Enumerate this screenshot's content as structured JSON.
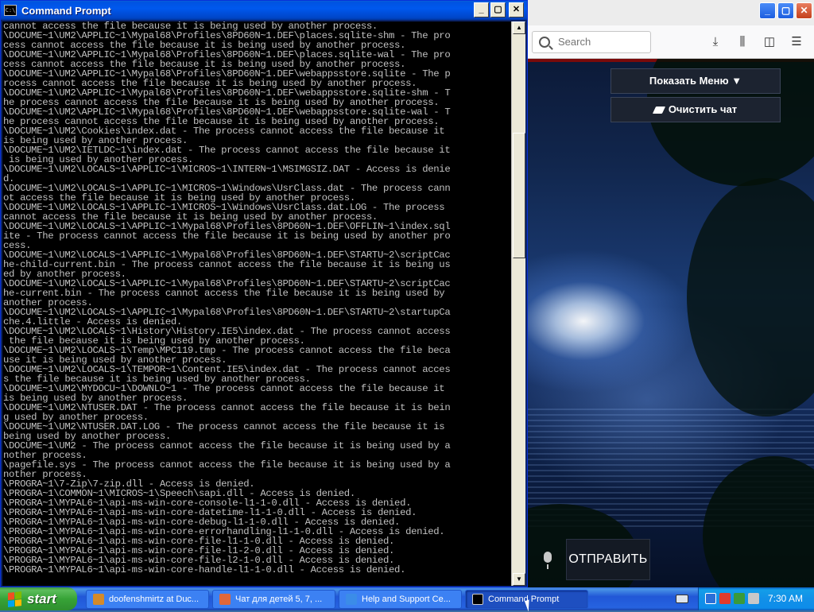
{
  "cmd": {
    "title": "Command Prompt",
    "icon": "C:\\",
    "buttons": {
      "minimize": "_",
      "maximize": "▢",
      "close": "✕"
    },
    "lines": [
      "cannot access the file because it is being used by another process.",
      "\\DOCUME~1\\UM2\\APPLIC~1\\Mypal68\\Profiles\\8PD60N~1.DEF\\places.sqlite-shm - The pro",
      "cess cannot access the file because it is being used by another process.",
      "\\DOCUME~1\\UM2\\APPLIC~1\\Mypal68\\Profiles\\8PD60N~1.DEF\\places.sqlite-wal - The pro",
      "cess cannot access the file because it is being used by another process.",
      "\\DOCUME~1\\UM2\\APPLIC~1\\Mypal68\\Profiles\\8PD60N~1.DEF\\webappsstore.sqlite - The p",
      "rocess cannot access the file because it is being used by another process.",
      "\\DOCUME~1\\UM2\\APPLIC~1\\Mypal68\\Profiles\\8PD60N~1.DEF\\webappsstore.sqlite-shm - T",
      "he process cannot access the file because it is being used by another process.",
      "\\DOCUME~1\\UM2\\APPLIC~1\\Mypal68\\Profiles\\8PD60N~1.DEF\\webappsstore.sqlite-wal - T",
      "he process cannot access the file because it is being used by another process.",
      "\\DOCUME~1\\UM2\\Cookies\\index.dat - The process cannot access the file because it",
      "is being used by another process.",
      "\\DOCUME~1\\UM2\\IETLDC~1\\index.dat - The process cannot access the file because it",
      " is being used by another process.",
      "\\DOCUME~1\\UM2\\LOCALS~1\\APPLIC~1\\MICROS~1\\INTERN~1\\MSIMGSIZ.DAT - Access is denie",
      "d.",
      "\\DOCUME~1\\UM2\\LOCALS~1\\APPLIC~1\\MICROS~1\\Windows\\UsrClass.dat - The process cann",
      "ot access the file because it is being used by another process.",
      "\\DOCUME~1\\UM2\\LOCALS~1\\APPLIC~1\\MICROS~1\\Windows\\UsrClass.dat.LOG - The process",
      "cannot access the file because it is being used by another process.",
      "\\DOCUME~1\\UM2\\LOCALS~1\\APPLIC~1\\Mypal68\\Profiles\\8PD60N~1.DEF\\OFFLIN~1\\index.sql",
      "ite - The process cannot access the file because it is being used by another pro",
      "cess.",
      "\\DOCUME~1\\UM2\\LOCALS~1\\APPLIC~1\\Mypal68\\Profiles\\8PD60N~1.DEF\\STARTU~2\\scriptCac",
      "he-child-current.bin - The process cannot access the file because it is being us",
      "ed by another process.",
      "\\DOCUME~1\\UM2\\LOCALS~1\\APPLIC~1\\Mypal68\\Profiles\\8PD60N~1.DEF\\STARTU~2\\scriptCac",
      "he-current.bin - The process cannot access the file because it is being used by",
      "another process.",
      "\\DOCUME~1\\UM2\\LOCALS~1\\APPLIC~1\\Mypal68\\Profiles\\8PD60N~1.DEF\\STARTU~2\\startupCa",
      "che.4.little - Access is denied.",
      "\\DOCUME~1\\UM2\\LOCALS~1\\History\\History.IE5\\index.dat - The process cannot access",
      " the file because it is being used by another process.",
      "\\DOCUME~1\\UM2\\LOCALS~1\\Temp\\MPC119.tmp - The process cannot access the file beca",
      "use it is being used by another process.",
      "\\DOCUME~1\\UM2\\LOCALS~1\\TEMPOR~1\\Content.IE5\\index.dat - The process cannot acces",
      "s the file because it is being used by another process.",
      "\\DOCUME~1\\UM2\\MYDOCU~1\\DOWNLO~1 - The process cannot access the file because it",
      "is being used by another process.",
      "\\DOCUME~1\\UM2\\NTUSER.DAT - The process cannot access the file because it is bein",
      "g used by another process.",
      "\\DOCUME~1\\UM2\\NTUSER.DAT.LOG - The process cannot access the file because it is",
      "being used by another process.",
      "\\DOCUME~1\\UM2 - The process cannot access the file because it is being used by a",
      "nother process.",
      "\\pagefile.sys - The process cannot access the file because it is being used by a",
      "nother process.",
      "\\PROGRA~1\\7-Zip\\7-zip.dll - Access is denied.",
      "\\PROGRA~1\\COMMON~1\\MICROS~1\\Speech\\sapi.dll - Access is denied.",
      "\\PROGRA~1\\MYPAL6~1\\api-ms-win-core-console-l1-1-0.dll - Access is denied.",
      "\\PROGRA~1\\MYPAL6~1\\api-ms-win-core-datetime-l1-1-0.dll - Access is denied.",
      "\\PROGRA~1\\MYPAL6~1\\api-ms-win-core-debug-l1-1-0.dll - Access is denied.",
      "\\PROGRA~1\\MYPAL6~1\\api-ms-win-core-errorhandling-l1-1-0.dll - Access is denied.",
      "\\PROGRA~1\\MYPAL6~1\\api-ms-win-core-file-l1-1-0.dll - Access is denied.",
      "\\PROGRA~1\\MYPAL6~1\\api-ms-win-core-file-l1-2-0.dll - Access is denied.",
      "\\PROGRA~1\\MYPAL6~1\\api-ms-win-core-file-l2-1-0.dll - Access is denied.",
      "\\PROGRA~1\\MYPAL6~1\\api-ms-win-core-handle-l1-1-0.dll - Access is denied."
    ]
  },
  "browser": {
    "buttons": {
      "minimize": "_",
      "maximize": "▢",
      "close": "✕"
    },
    "search": {
      "placeholder": "Search"
    },
    "toolbar_icons": {
      "download": "⤓",
      "library": "⫼",
      "sidebar": "◫",
      "menu": "☰"
    },
    "page": {
      "menu_button": "Показать Меню ▼",
      "clear_button": "Очистить чат",
      "send_button": "ОТПРАВИТЬ"
    }
  },
  "taskbar": {
    "start_label": "start",
    "tasks": [
      {
        "label": "doofenshmirtz at Duc...",
        "icon_color": "#d48a2a"
      },
      {
        "label": "Чат для детей 5, 7, ...",
        "icon_color": "#e0673a"
      },
      {
        "label": "Help and Support Ce...",
        "icon_color": "#3b8ce8"
      },
      {
        "label": "Command Prompt",
        "icon_color": "#000000",
        "active": true
      }
    ],
    "clock": "7:30 AM"
  },
  "colors": {
    "xp_blue": "#0058ee",
    "start_green": "#37a337",
    "cmd_text": "#c0c0c0"
  }
}
